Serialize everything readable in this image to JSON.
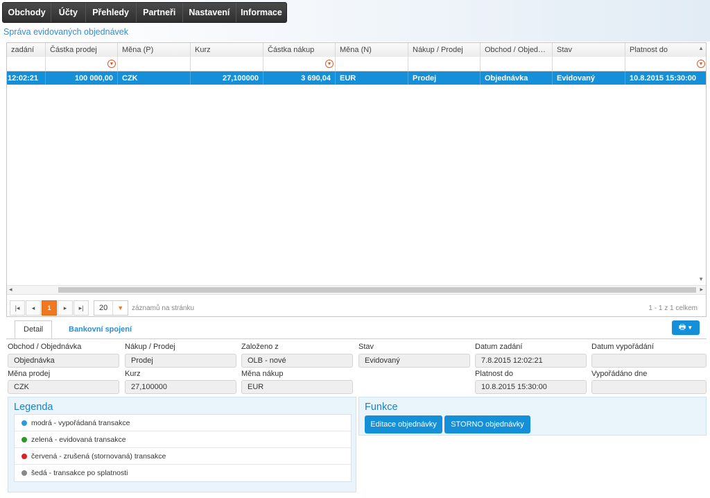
{
  "nav": {
    "items": [
      "Obchody",
      "Účty",
      "Přehledy",
      "Partneři",
      "Nastavení",
      "Informace"
    ]
  },
  "page": {
    "title": "Správa evidovaných objednávek"
  },
  "grid": {
    "columns": [
      "zadání",
      "Částka prodej",
      "Měna (P)",
      "Kurz",
      "Částka nákup",
      "Měna (N)",
      "Nákup / Prodej",
      "Obchod / Objed…",
      "Stav",
      "Platnost do"
    ],
    "rows": [
      [
        "12:02:21",
        "100 000,00",
        "CZK",
        "27,100000",
        "3 690,04",
        "EUR",
        "Prodej",
        "Objednávka",
        "Evidovaný",
        "10.8.2015 15:30:00"
      ]
    ],
    "selected_row_color": "#1590d8"
  },
  "pager": {
    "first_icon": "first-page-icon",
    "prev_icon": "prev-page-icon",
    "current_page": "1",
    "next_icon": "next-page-icon",
    "last_icon": "last-page-icon",
    "page_size": "20",
    "page_size_label": "záznamů na stránku",
    "info": "1 - 1 z 1 celkem"
  },
  "tabs": {
    "detail": "Detail",
    "bank": "Bankovní spojení"
  },
  "detail": {
    "obchod_label": "Obchod / Objednávka",
    "obchod_value": "Objednávka",
    "nakup_label": "Nákup / Prodej",
    "nakup_value": "Prodej",
    "zalozeno_label": "Založeno z",
    "zalozeno_value": "OLB - nové",
    "stav_label": "Stav",
    "stav_value": "Evidovaný",
    "datum_zadani_label": "Datum zadání",
    "datum_zadani_value": "7.8.2015 12:02:21",
    "datum_vyporadani_label": "Datum vypořádání",
    "datum_vyporadani_value": "",
    "mena_prodej_label": "Měna prodej",
    "mena_prodej_value": "CZK",
    "kurz_label": "Kurz",
    "kurz_value": "27,100000",
    "mena_nakup_label": "Měna nákup",
    "mena_nakup_value": "EUR",
    "platnost_label": "Platnost do",
    "platnost_value": "10.8.2015 15:30:00",
    "vyporadano_label": "Vypořádáno dne",
    "vyporadano_value": ""
  },
  "legend": {
    "title": "Legenda",
    "items": [
      {
        "text": "modrá - vypořádaná transakce",
        "color": "#2b9be0"
      },
      {
        "text": "zelená - evidovaná transakce",
        "color": "#2a9a2a"
      },
      {
        "text": "červená - zrušená (stornovaná) transakce",
        "color": "#e02020"
      },
      {
        "text": "šedá - transakce po splatnosti",
        "color": "#888888"
      }
    ]
  },
  "functions": {
    "title": "Funkce",
    "edit_label": "Editace objednávky",
    "storno_label": "STORNO objednávky"
  }
}
